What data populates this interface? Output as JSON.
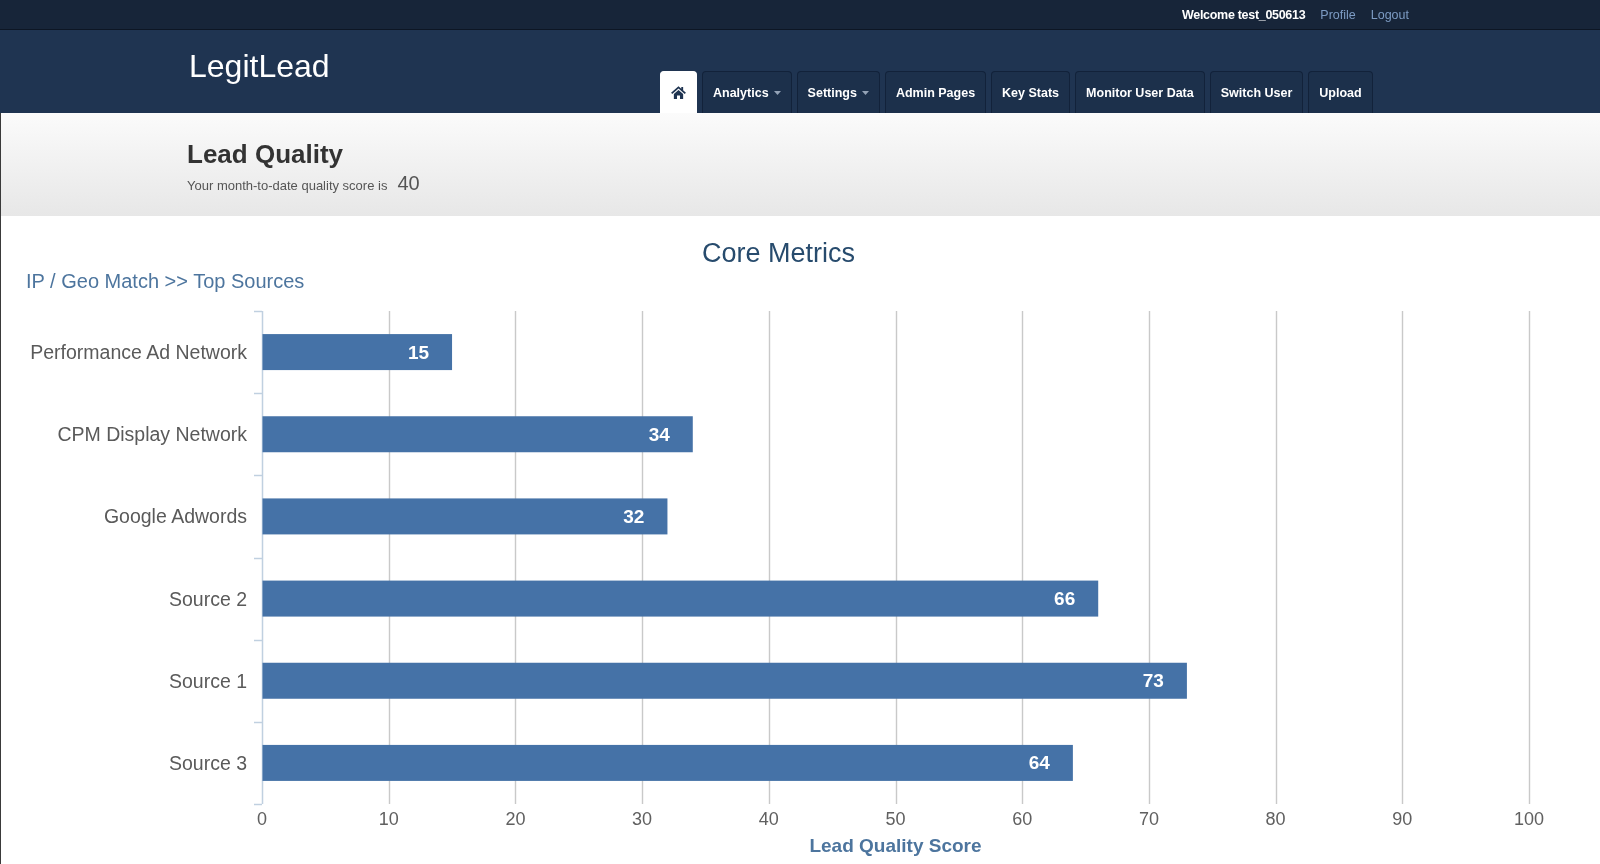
{
  "top_bar": {
    "welcome": "Welcome test_050613",
    "links": [
      "Profile",
      "Logout"
    ]
  },
  "navbar": {
    "brand": "LegitLead",
    "tabs": [
      {
        "kind": "icon",
        "selected": true
      },
      {
        "kind": "dropdown",
        "label": "Analytics",
        "selected": false
      },
      {
        "kind": "dropdown",
        "label": "Settings",
        "selected": false
      },
      {
        "kind": "plain",
        "label": "Admin Pages",
        "selected": false
      },
      {
        "kind": "plain",
        "label": "Key Stats",
        "selected": false
      },
      {
        "kind": "plain",
        "label": "Monitor User Data",
        "selected": false
      },
      {
        "kind": "plain",
        "label": "Switch User",
        "selected": false
      },
      {
        "kind": "plain",
        "label": "Upload",
        "selected": false
      }
    ]
  },
  "header": {
    "title": "Lead Quality",
    "subtitle": "Your month-to-date quality score is",
    "score": "40"
  },
  "chart": {
    "title": "Core Metrics",
    "breadcrumb": "IP / Geo Match >> Top Sources",
    "chart_data": {
      "type": "bar",
      "orientation": "horizontal",
      "xlabel": "Lead Quality Score",
      "categories": [
        "Performance Ad Network",
        "CPM Display Network",
        "Google Adwords",
        "Source 2",
        "Source 1",
        "Source 3"
      ],
      "series": [
        {
          "color": "#4572a7",
          "values": [
            15,
            34,
            32,
            66,
            73,
            64
          ]
        }
      ],
      "xlim": [
        0,
        100
      ],
      "xticks": [
        0,
        10,
        20,
        30,
        40,
        50,
        60,
        70,
        80,
        90,
        100
      ],
      "grid": true,
      "data_labels": true
    }
  }
}
